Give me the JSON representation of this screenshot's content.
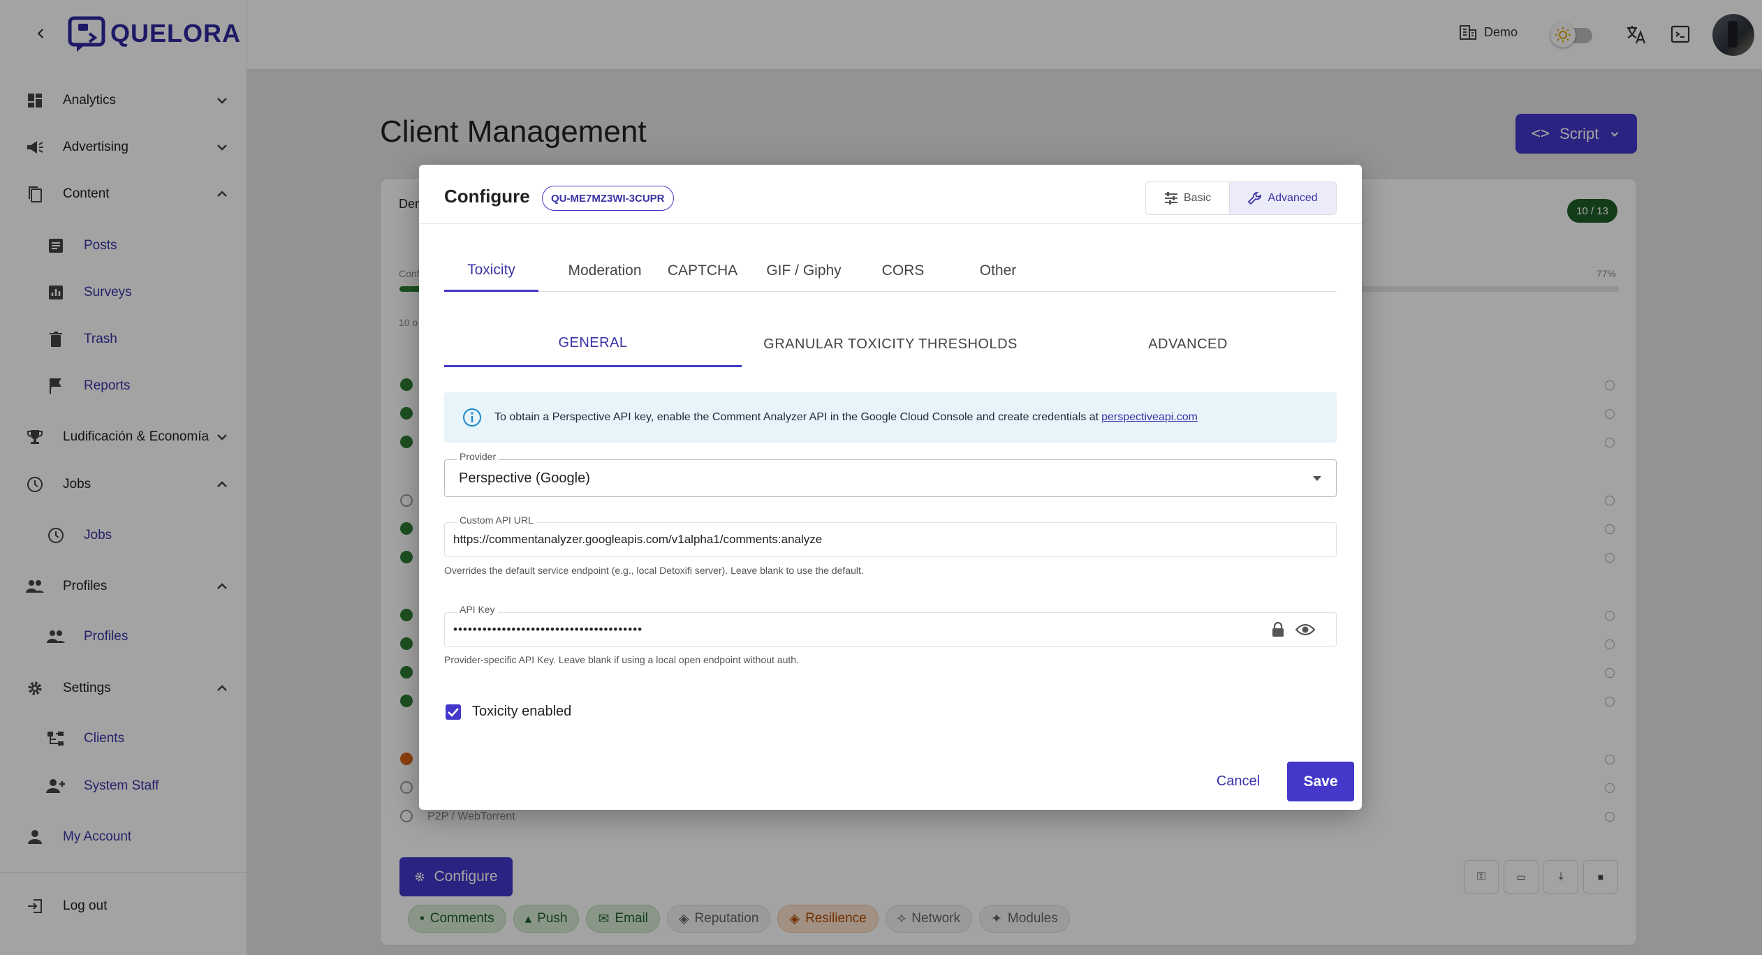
{
  "brand": {
    "name": "QUELORA",
    "color": "#2f2aa0"
  },
  "header": {
    "org_label": "Demo",
    "theme_toggle_icon": "sun-icon",
    "translate_icon": "translate-icon",
    "terminal_icon": "terminal-icon",
    "avatar_icon": "avatar"
  },
  "sidebar": {
    "sections": [
      {
        "label": "Analytics",
        "icon": "dashboard-icon",
        "expanded": false
      },
      {
        "label": "Advertising",
        "icon": "campaign-icon",
        "expanded": false
      },
      {
        "label": "Content",
        "icon": "copy-icon",
        "expanded": true
      },
      {
        "label": "Ludificación & Economía",
        "icon": "trophy-icon",
        "expanded": false
      },
      {
        "label": "Jobs",
        "icon": "clock-icon",
        "expanded": true
      },
      {
        "label": "Profiles",
        "icon": "people-icon",
        "expanded": true
      },
      {
        "label": "Settings",
        "icon": "gear-icon",
        "expanded": true
      }
    ],
    "items": {
      "posts": "Posts",
      "surveys": "Surveys",
      "trash": "Trash",
      "reports": "Reports",
      "jobs": "Jobs",
      "profiles": "Profiles",
      "clients": "Clients",
      "system_staff": "System Staff"
    },
    "my_account": "My Account",
    "logout": "Log out"
  },
  "page": {
    "title": "Client Management",
    "script_button": "Script",
    "badge_count": "10 / 13",
    "progress_label": "77%",
    "progress_fraction": 0.77,
    "bg_fragments": {
      "title": "Den",
      "conf": "Conf",
      "count": "10 o",
      "p2p": "P2P / WebTorrent"
    },
    "configure_button": "Configure",
    "chips": [
      {
        "label": "Comments",
        "style": "green",
        "icon": "comment-icon"
      },
      {
        "label": "Push",
        "style": "green",
        "icon": "bell-icon"
      },
      {
        "label": "Email",
        "style": "green",
        "icon": "mail-icon"
      },
      {
        "label": "Reputation",
        "style": "grey",
        "icon": "shield-icon"
      },
      {
        "label": "Resilience",
        "style": "orange",
        "icon": "shield-icon"
      },
      {
        "label": "Network",
        "style": "grey",
        "icon": "network-icon"
      },
      {
        "label": "Modules",
        "style": "grey",
        "icon": "puzzle-icon"
      }
    ]
  },
  "modal": {
    "title": "Configure",
    "client_id": "QU-ME7MZ3WI-3CUPR",
    "mode_basic": "Basic",
    "mode_advanced": "Advanced",
    "tabs": [
      "Toxicity",
      "Moderation",
      "CAPTCHA",
      "GIF / Giphy",
      "CORS",
      "Other"
    ],
    "active_tab": "Toxicity",
    "subtabs": [
      "GENERAL",
      "GRANULAR TOXICITY THRESHOLDS",
      "ADVANCED"
    ],
    "active_subtab": "GENERAL",
    "alert_text": "To obtain a Perspective API key, enable the Comment Analyzer API in the Google Cloud Console and create credentials at",
    "alert_link": "perspectiveapi.com",
    "provider_label": "Provider",
    "provider_value": "Perspective (Google)",
    "api_url_label": "Custom API URL",
    "api_url_value": "https://commentanalyzer.googleapis.com/v1alpha1/comments:analyze",
    "api_url_helper": "Overrides the default service endpoint (e.g., local Detoxifi server). Leave blank to use the default.",
    "api_key_label": "API Key",
    "api_key_value": "•••••••••••••••••••••••••••••••••••••••",
    "api_key_helper": "Provider-specific API Key. Leave blank if using a local open endpoint without auth.",
    "toxicity_enabled_label": "Toxicity enabled",
    "toxicity_enabled": true,
    "cancel_label": "Cancel",
    "save_label": "Save"
  },
  "colors": {
    "primary": "#4338ca",
    "success": "#2e7d32",
    "info_bg": "#e7f4fa"
  }
}
